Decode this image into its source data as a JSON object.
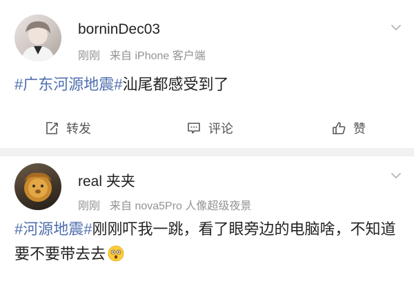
{
  "posts": [
    {
      "username": "borninDec03",
      "time": "刚刚",
      "source": "来自 iPhone 客户端",
      "hashtag": "#广东河源地震#",
      "text": "汕尾都感受到了",
      "actions": {
        "repost": "转发",
        "comment": "评论",
        "like": "赞"
      }
    },
    {
      "username": "real 夹夹",
      "time": "刚刚",
      "source": "来自 nova5Pro 人像超级夜景",
      "hashtag": "#河源地震#",
      "text": "刚刚吓我一跳，看了眼旁边的电脑啥，不知道要不要带去去"
    }
  ],
  "colors": {
    "hashtag": "#4f6fae",
    "meta": "#939393",
    "divider": "#f1f1f1"
  },
  "icons": [
    "avatar",
    "chevron-down-icon",
    "repost-icon",
    "comment-icon",
    "like-icon",
    "astonished-emoji-icon"
  ]
}
